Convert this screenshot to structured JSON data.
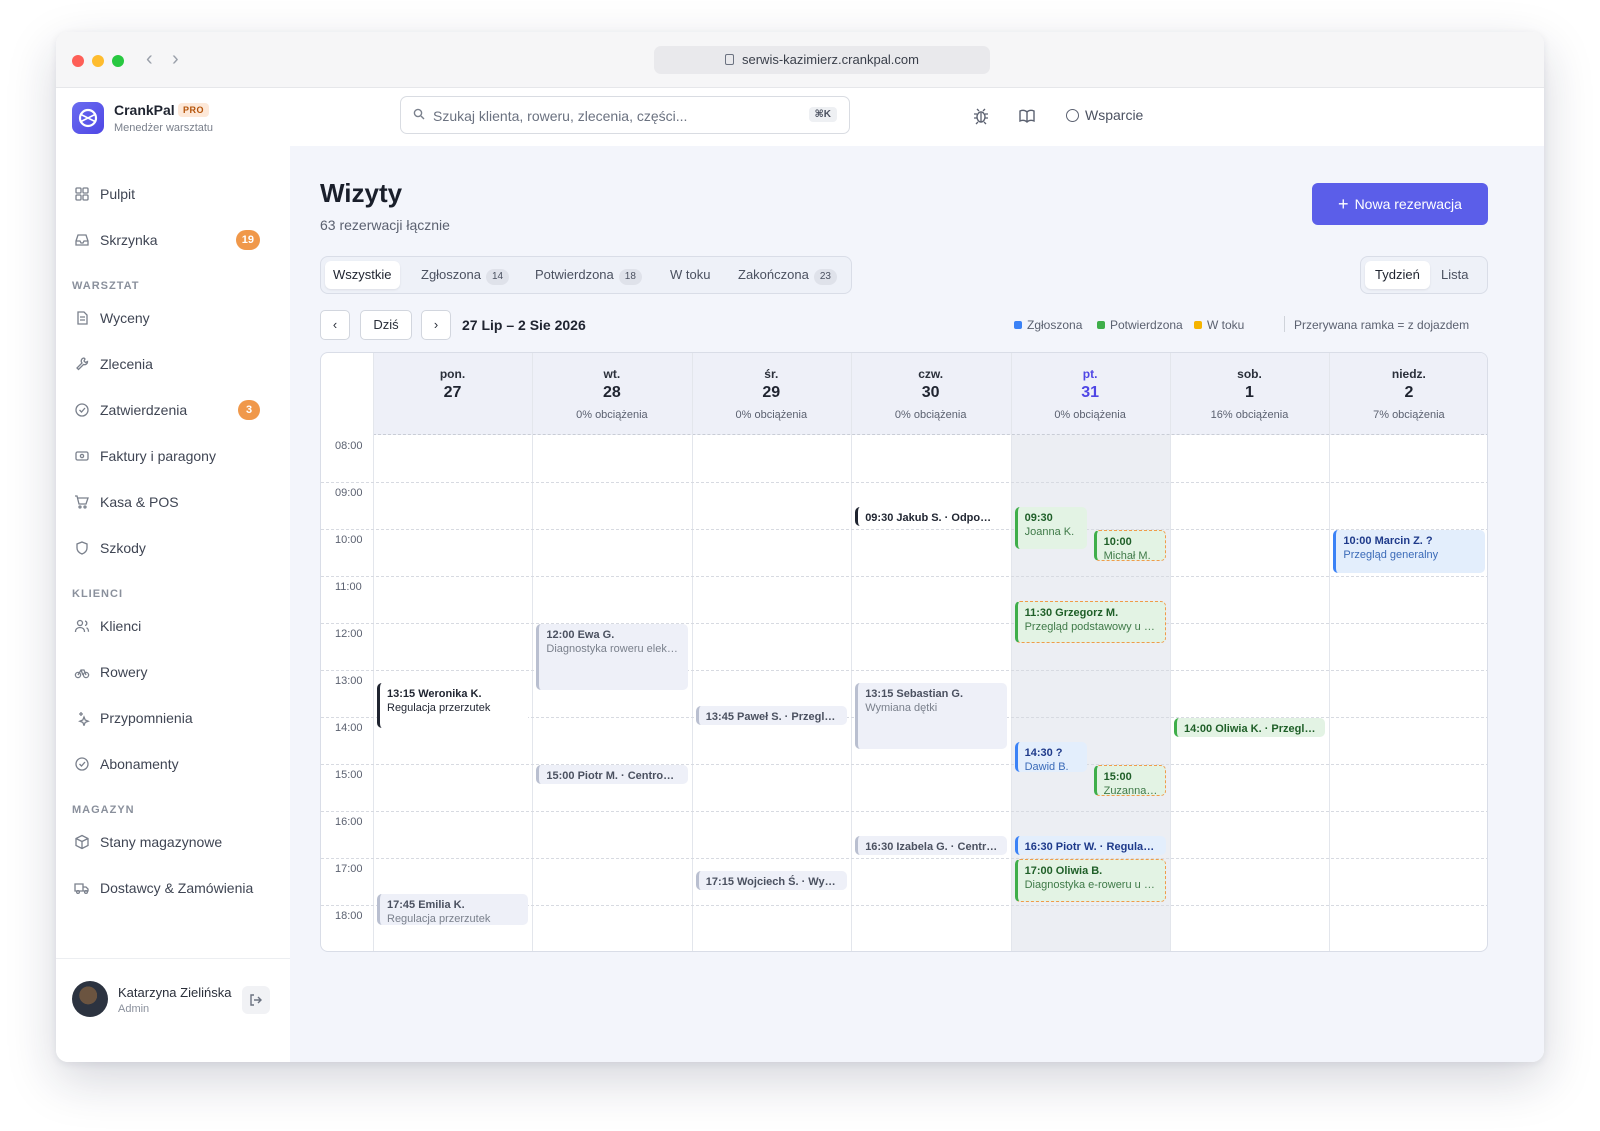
{
  "browser": {
    "url": "serwis-kazimierz.crankpal.com"
  },
  "brand": {
    "name": "CrankPal",
    "badge": "PRO",
    "subtitle": "Menedżer warsztatu"
  },
  "search": {
    "placeholder": "Szukaj klienta, roweru, zlecenia, części...",
    "shortcut": "⌘K"
  },
  "header": {
    "support_label": "Wsparcie"
  },
  "sidebar": {
    "top": [
      {
        "label": "Pulpit",
        "icon": "grid-icon"
      },
      {
        "label": "Skrzynka",
        "icon": "inbox-icon",
        "count": "19"
      }
    ],
    "sections": [
      {
        "title": "WARSZTAT",
        "items": [
          {
            "label": "Wyceny",
            "icon": "document-icon"
          },
          {
            "label": "Zlecenia",
            "icon": "wrench-icon"
          },
          {
            "label": "Zatwierdzenia",
            "icon": "check-circle-icon",
            "count": "3"
          },
          {
            "label": "Faktury i paragony",
            "icon": "receipt-icon"
          },
          {
            "label": "Kasa & POS",
            "icon": "cart-icon"
          },
          {
            "label": "Szkody",
            "icon": "shield-icon"
          }
        ]
      },
      {
        "title": "KLIENCI",
        "items": [
          {
            "label": "Klienci",
            "icon": "users-icon"
          },
          {
            "label": "Rowery",
            "icon": "bike-icon"
          },
          {
            "label": "Przypomnienia",
            "icon": "sparkle-icon"
          },
          {
            "label": "Abonamenty",
            "icon": "check-circle-icon"
          }
        ]
      },
      {
        "title": "MAGAZYN",
        "items": [
          {
            "label": "Stany magazynowe",
            "icon": "box-icon"
          },
          {
            "label": "Dostawcy & Zamówienia",
            "icon": "truck-icon"
          }
        ]
      }
    ]
  },
  "user": {
    "name": "Katarzyna Zielińska",
    "role": "Admin"
  },
  "page": {
    "title": "Wizyty",
    "subtitle": "63 rezerwacji łącznie",
    "new_button": "Nowa rezerwacja"
  },
  "filters": [
    {
      "label": "Wszystkie",
      "count": "",
      "active": true
    },
    {
      "label": "Zgłoszona",
      "count": "14"
    },
    {
      "label": "Potwierdzona",
      "count": "18"
    },
    {
      "label": "W toku",
      "count": ""
    },
    {
      "label": "Zakończona",
      "count": "23"
    }
  ],
  "views": [
    {
      "label": "Tydzień",
      "active": true
    },
    {
      "label": "Lista"
    }
  ],
  "calendar_nav": {
    "prev": "‹",
    "today": "Dziś",
    "next": "›",
    "range": "27 Lip – 2 Sie 2026"
  },
  "legend": {
    "items": [
      {
        "label": "Zgłoszona",
        "color": "#3b82f6"
      },
      {
        "label": "Potwierdzona",
        "color": "#3fae4a"
      },
      {
        "label": "W toku",
        "color": "#f5b400"
      }
    ],
    "note": "Przerywana ramka = z dojazdem"
  },
  "days": [
    {
      "name": "pon.",
      "num": "27",
      "load": ""
    },
    {
      "name": "wt.",
      "num": "28",
      "load": "0% obciążenia"
    },
    {
      "name": "śr.",
      "num": "29",
      "load": "0% obciążenia"
    },
    {
      "name": "czw.",
      "num": "30",
      "load": "0% obciążenia"
    },
    {
      "name": "pt.",
      "num": "31",
      "load": "0% obciążenia",
      "today": true
    },
    {
      "name": "sob.",
      "num": "1",
      "load": "16% obciążenia"
    },
    {
      "name": "niedz.",
      "num": "2",
      "load": "7% obciążenia"
    }
  ],
  "hours": [
    "08:00",
    "09:00",
    "10:00",
    "11:00",
    "12:00",
    "13:00",
    "14:00",
    "15:00",
    "16:00",
    "17:00",
    "18:00"
  ],
  "events": [
    {
      "day": 0,
      "start": 13.25,
      "dur": 1.0,
      "title": "13:15 Weronika K.",
      "sub": "Regulacja przerzutek",
      "style": "black"
    },
    {
      "day": 0,
      "start": 17.75,
      "dur": 0.7,
      "title": "17:45 Emilia K.",
      "sub": "Regulacja przerzutek",
      "style": "grey"
    },
    {
      "day": 1,
      "start": 12.0,
      "dur": 1.45,
      "title": "12:00 Ewa G.",
      "sub": "Diagnostyka roweru elektr...",
      "style": "grey"
    },
    {
      "day": 1,
      "start": 15.0,
      "dur": 0.45,
      "title": "15:00 Piotr M. · Centrowa...",
      "sub": "",
      "style": "grey"
    },
    {
      "day": 2,
      "start": 13.75,
      "dur": 0.45,
      "title": "13:45 Paweł S. · Przegląd...",
      "sub": "",
      "style": "grey"
    },
    {
      "day": 2,
      "start": 17.25,
      "dur": 0.45,
      "title": "17:15 Wojciech Ś. · Wymi...",
      "sub": "",
      "style": "grey"
    },
    {
      "day": 3,
      "start": 9.5,
      "dur": 0.45,
      "title": "09:30 Jakub S. · Odpowie...",
      "sub": "",
      "style": "black"
    },
    {
      "day": 3,
      "start": 13.25,
      "dur": 1.45,
      "title": "13:15 Sebastian G.",
      "sub": "Wymiana dętki",
      "style": "grey"
    },
    {
      "day": 3,
      "start": 16.5,
      "dur": 0.45,
      "title": "16:30 Izabela G. · Centro...",
      "sub": "",
      "style": "grey"
    },
    {
      "day": 4,
      "start": 9.5,
      "dur": 0.95,
      "title": "09:30",
      "sub": "Joanna K.",
      "style": "green",
      "half": "left"
    },
    {
      "day": 4,
      "start": 10.0,
      "dur": 0.7,
      "title": "10:00",
      "sub": "Michał M.",
      "style": "green dashed",
      "half": "right"
    },
    {
      "day": 4,
      "start": 11.5,
      "dur": 0.95,
      "title": "11:30 Grzegorz M.",
      "sub": "Przegląd podstawowy u kl...",
      "style": "green dashed"
    },
    {
      "day": 4,
      "start": 14.5,
      "dur": 0.7,
      "title": "14:30 ?",
      "sub": "Dawid B.",
      "style": "blue",
      "half": "left"
    },
    {
      "day": 4,
      "start": 15.0,
      "dur": 0.7,
      "title": "15:00",
      "sub": "Zuzanna G.",
      "style": "green dashed",
      "half": "right"
    },
    {
      "day": 4,
      "start": 16.5,
      "dur": 0.45,
      "title": "16:30 Piotr W. · Regulacj...",
      "sub": "",
      "style": "blue"
    },
    {
      "day": 4,
      "start": 17.0,
      "dur": 0.95,
      "title": "17:00 Oliwia B.",
      "sub": "Diagnostyka e-roweru u kl...",
      "style": "green dashed"
    },
    {
      "day": 5,
      "start": 14.0,
      "dur": 0.45,
      "title": "14:00 Oliwia K. · Przeglą...",
      "sub": "",
      "style": "green"
    },
    {
      "day": 6,
      "start": 10.0,
      "dur": 0.95,
      "title": "10:00 Marcin Z. ?",
      "sub": "Przegląd generalny",
      "style": "blue"
    }
  ]
}
